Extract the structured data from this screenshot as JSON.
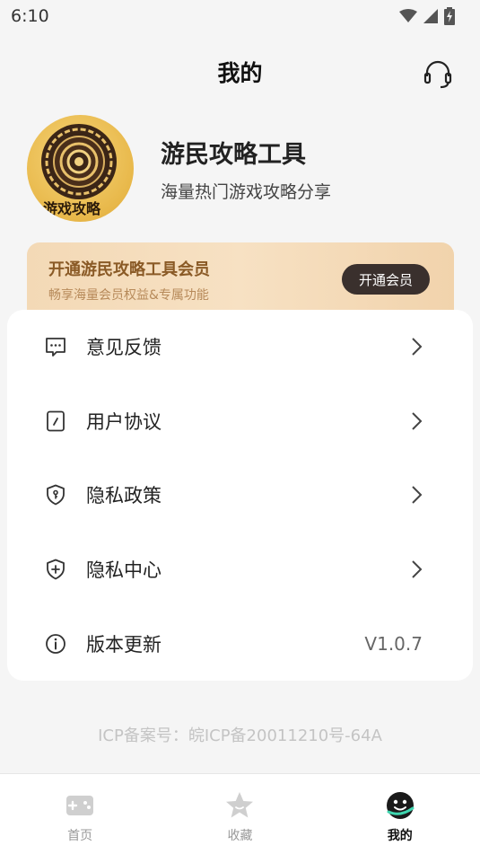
{
  "status_bar": {
    "time": "6:10"
  },
  "header": {
    "title": "我的"
  },
  "profile": {
    "avatar_text": "游戏攻略",
    "name": "游民攻略工具",
    "description": "海量热门游戏攻略分享"
  },
  "vip": {
    "title": "开通游民攻略工具会员",
    "subtitle": "畅享海量会员权益&专属功能",
    "button": "开通会员"
  },
  "menu": {
    "items": [
      {
        "label": "意见反馈",
        "icon": "feedback-icon"
      },
      {
        "label": "用户协议",
        "icon": "agreement-icon"
      },
      {
        "label": "隐私政策",
        "icon": "privacy-policy-icon"
      },
      {
        "label": "隐私中心",
        "icon": "privacy-center-icon"
      },
      {
        "label": "版本更新",
        "icon": "info-icon",
        "value": "V1.0.7"
      }
    ]
  },
  "icp": "ICP备案号：皖ICP备20011210号-64A",
  "tabbar": {
    "tabs": [
      {
        "label": "首页",
        "icon": "gamepad-icon",
        "active": false
      },
      {
        "label": "收藏",
        "icon": "star-icon",
        "active": false
      },
      {
        "label": "我的",
        "icon": "smiley-icon",
        "active": true
      }
    ]
  }
}
